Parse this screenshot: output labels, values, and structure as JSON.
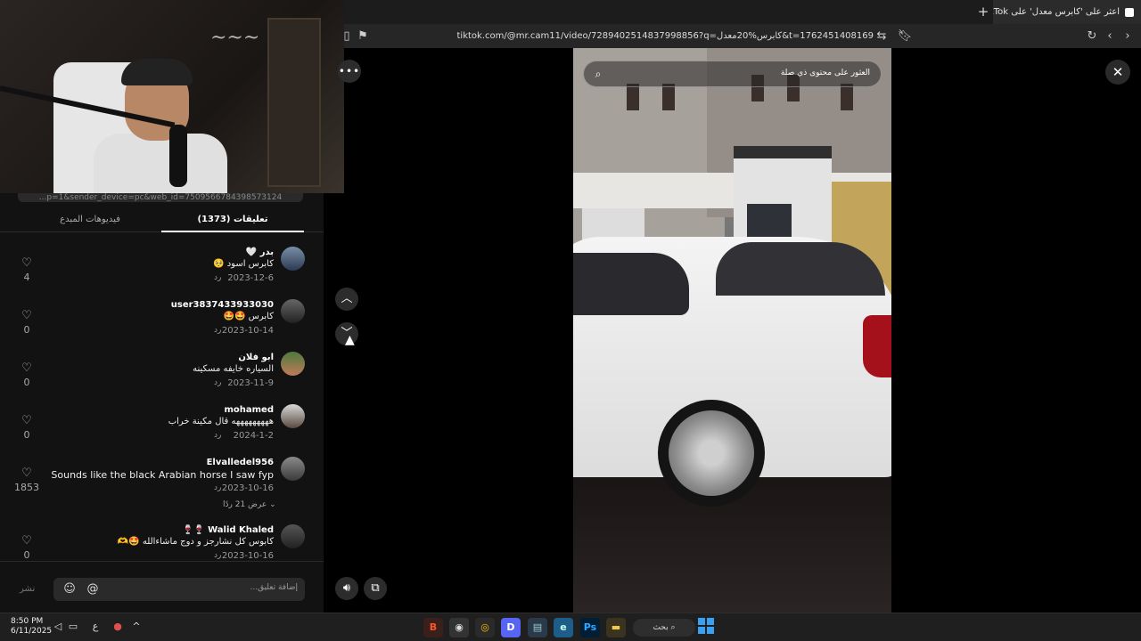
{
  "browser": {
    "tab_title": "اعثر على 'كابرس معدل' على TikTok",
    "url": "tiktok.com/@mr.cam11/video/7289402514837998856?q=كابرس%20معدل&t=1762451408169"
  },
  "panel": {
    "copy_link_text": "...p=1&sender_device=pc&web_id=7509566784398573124",
    "tabs": {
      "comments": "تعليقات (1373)",
      "creator_videos": "فيديوهات المبدع"
    },
    "reply_label": "رد",
    "comments": [
      {
        "user": "بدر 🤍",
        "text": "كابرس اسود 🥺",
        "date": "2023-12-6",
        "likes": "4"
      },
      {
        "user": "user3837433933030",
        "text": "كابرس 🤩🤩",
        "date": "2023-10-14",
        "likes": "0"
      },
      {
        "user": "ابو فلان",
        "text": "السياره خايفه مسكينه",
        "date": "2023-11-9",
        "likes": "0"
      },
      {
        "user": "mohamed",
        "text": "هههههههههه قال مكينة خراب",
        "date": "2024-1-2",
        "likes": "0"
      },
      {
        "user": "Elvalledel956",
        "text": "Sounds like the black Arabian horse I saw fyp",
        "date": "2023-10-16",
        "likes": "1853"
      },
      {
        "user": "Walid Khaled 🍷🍷",
        "text": "كابوس كل نشارجز و دوج ماشاءالله 🤩🫶",
        "date": "2023-10-16",
        "likes": "0"
      }
    ],
    "view_replies": "عرض 21 ردًا",
    "comment_placeholder": "إضافة تعليق...",
    "post_label": "نشر"
  },
  "video": {
    "search_placeholder": "العثور على محتوى ذي صلة"
  },
  "taskbar": {
    "time": "8:50 PM",
    "date": "6/11/2025",
    "lang": "ع",
    "search_label": "بحث"
  }
}
